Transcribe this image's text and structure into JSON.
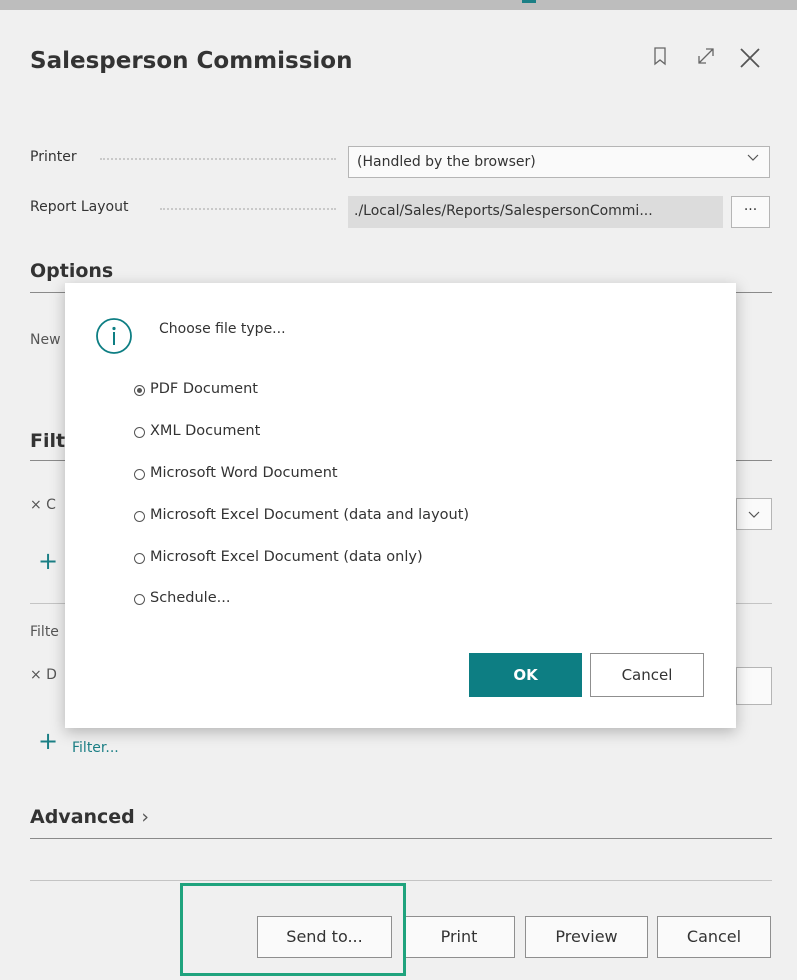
{
  "header": {
    "title": "Salesperson Commission",
    "icons": [
      "bookmark-icon",
      "expand-icon",
      "close-icon"
    ]
  },
  "fields": {
    "printer": {
      "label": "Printer",
      "value": "(Handled by the browser)"
    },
    "report_layout": {
      "label": "Report Layout",
      "value": "./Local/Sales/Reports/SalespersonCommi...",
      "button": "···"
    }
  },
  "sections": {
    "options": "Options",
    "advanced": "Advanced",
    "advanced_chevron": "›"
  },
  "background_fragments": {
    "options_row": "New",
    "filter_section_title": "Filt",
    "filter_row1": "× C",
    "filter_title2": "Filte",
    "filter_row2": "× D",
    "add_filter_link": "Filter...",
    "plus": "+"
  },
  "dialog": {
    "prompt": "Choose file type...",
    "options": [
      {
        "label": "PDF Document",
        "checked": true
      },
      {
        "label": "XML Document",
        "checked": false
      },
      {
        "label": "Microsoft Word Document",
        "checked": false
      },
      {
        "label": "Microsoft Excel Document (data and layout)",
        "checked": false
      },
      {
        "label": "Microsoft Excel Document (data only)",
        "checked": false
      },
      {
        "label": "Schedule...",
        "checked": false
      }
    ],
    "ok": "OK",
    "cancel": "Cancel"
  },
  "footer": {
    "send_to": "Send to...",
    "print": "Print",
    "preview": "Preview",
    "cancel": "Cancel"
  },
  "colors": {
    "accent": "#0d7e83",
    "highlight": "#1fa37d",
    "link": "#1b7f85"
  }
}
